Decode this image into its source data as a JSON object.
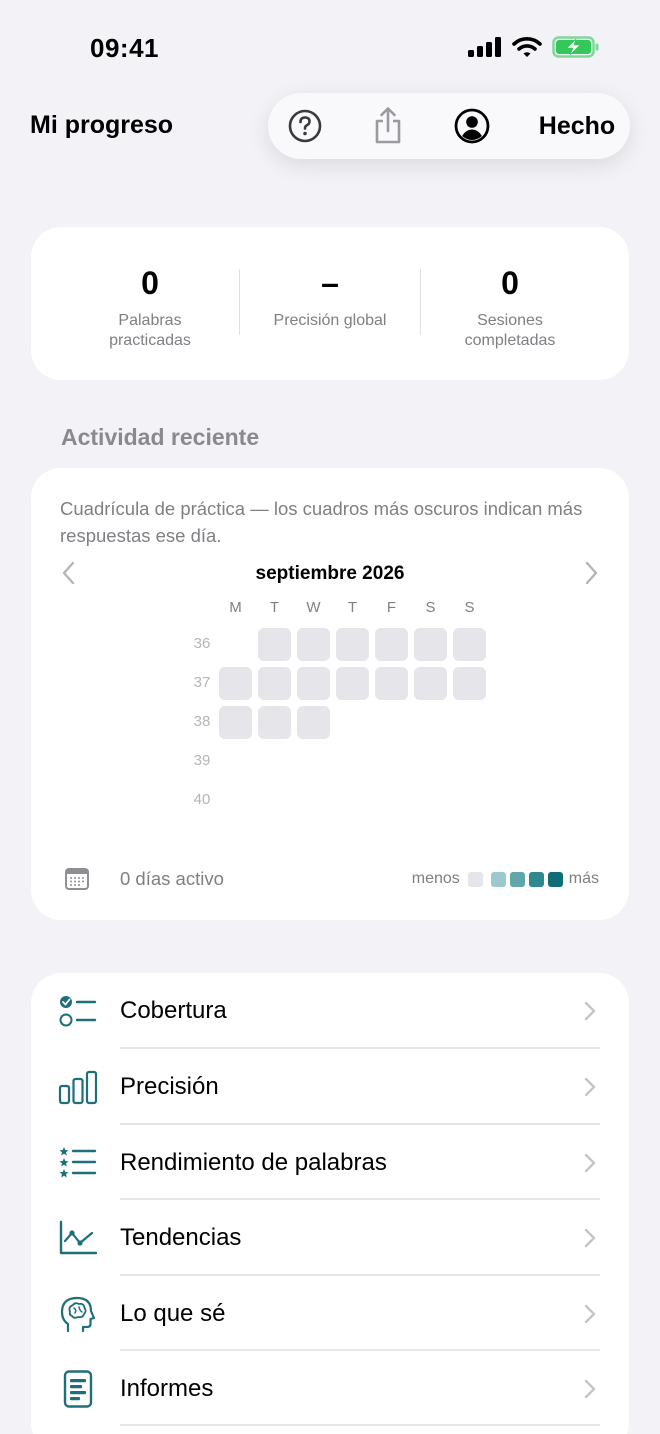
{
  "status_bar": {
    "time": "09:41"
  },
  "nav": {
    "title": "Mi progreso",
    "done_label": "Hecho"
  },
  "stats": [
    {
      "value": "0",
      "label": "Palabras practicadas"
    },
    {
      "value": "–",
      "label": "Precisión global"
    },
    {
      "value": "0",
      "label": "Sesiones completadas"
    }
  ],
  "activity": {
    "section_title": "Actividad reciente",
    "description": "Cuadrícula de práctica — los cuadros más oscuros indican más respuestas ese día.",
    "month": "septiembre 2026",
    "weekdays": [
      "M",
      "T",
      "W",
      "T",
      "F",
      "S",
      "S"
    ],
    "weeks": [
      "36",
      "37",
      "38",
      "39",
      "40"
    ],
    "days_active": "0 días activo",
    "legend_less": "menos",
    "legend_more": "más",
    "legend_colors": [
      "#e5e5ea",
      "#9cc9cd",
      "#5fa7ad",
      "#2f8790",
      "#0e6d77"
    ]
  },
  "menu": [
    {
      "label": "Cobertura",
      "icon": "coverage-checklist-icon"
    },
    {
      "label": "Precisión",
      "icon": "bar-chart-icon"
    },
    {
      "label": "Rendimiento de palabras",
      "icon": "star-list-icon"
    },
    {
      "label": "Tendencias",
      "icon": "trend-line-icon"
    },
    {
      "label": "Lo que sé",
      "icon": "brain-head-icon"
    },
    {
      "label": "Informes",
      "icon": "report-document-icon"
    }
  ],
  "colors": {
    "accent": "#1f6f7a",
    "background": "#f2f2f7",
    "empty_cell": "#e5e5ea"
  }
}
